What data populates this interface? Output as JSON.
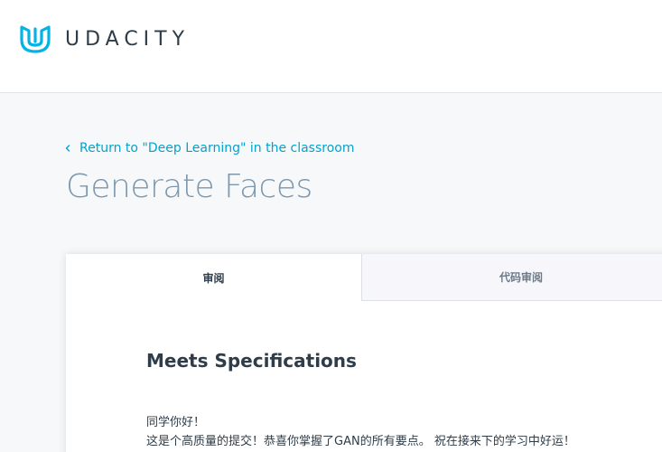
{
  "header": {
    "brand": "UDACITY",
    "brand_color": "#02b3e4"
  },
  "nav": {
    "back_link": "Return to \"Deep Learning\" in the classroom",
    "back_icon": "chevron-left-icon"
  },
  "page": {
    "title": "Generate Faces"
  },
  "tabs": [
    {
      "label": "审阅",
      "active": true
    },
    {
      "label": "代码审阅",
      "active": false
    }
  ],
  "review": {
    "heading": "Meets Specifications",
    "lines": [
      "同学你好！",
      "这是个高质量的提交！恭喜你掌握了GAN的所有要点。 祝在接来下的学习中好运！"
    ]
  },
  "colors": {
    "link": "#02a3ce",
    "title": "#7d97ad",
    "text": "#2e3d49"
  }
}
